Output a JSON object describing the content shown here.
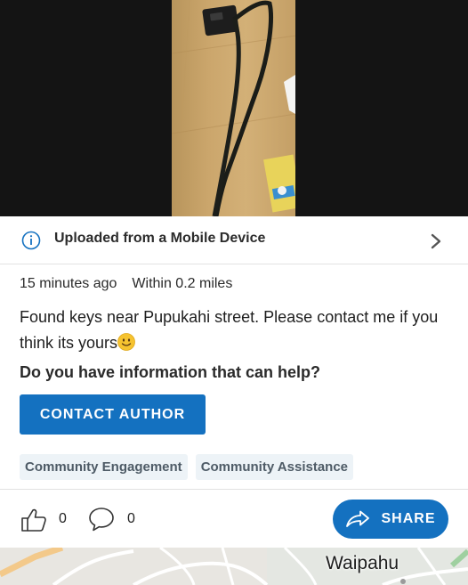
{
  "banner": {
    "label": "Uploaded from a Mobile Device",
    "info_icon": "info-circle-icon",
    "chevron_icon": "chevron-right-icon"
  },
  "post": {
    "time_ago": "15 minutes ago",
    "distance": "Within 0.2 miles",
    "message": "Found keys near Pupukahi street. Please contact me if you think its yours",
    "emoji": "smiling-face-emoji",
    "help_question": "Do you have information that can help?",
    "contact_button": "CONTACT AUTHOR",
    "tags": [
      "Community Engagement",
      "Community Assistance"
    ]
  },
  "actions": {
    "like_count": "0",
    "comment_count": "0",
    "share_label": "SHARE",
    "like_icon": "thumbs-up-icon",
    "comment_icon": "speech-bubble-icon",
    "share_icon": "share-arrow-icon"
  },
  "map": {
    "place_label": "Waipahu"
  },
  "colors": {
    "accent": "#1471c0",
    "tag_background": "#edf3f7",
    "photo_backdrop": "#141414"
  }
}
